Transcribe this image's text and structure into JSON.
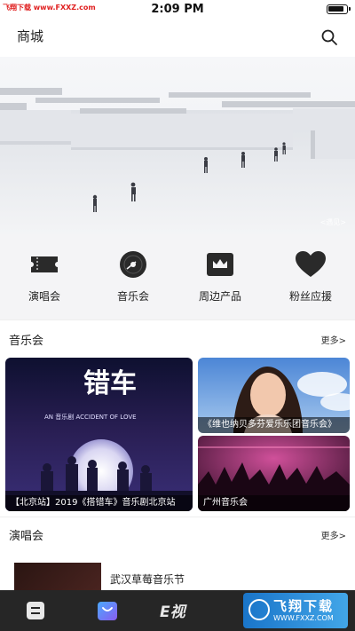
{
  "status_bar": {
    "watermark": "飞翔下载 www.FXXZ.com",
    "time": "2:09 PM"
  },
  "nav": {
    "title": "商城",
    "search_icon": "search-icon"
  },
  "hero": {
    "credit": "<遇见>"
  },
  "categories": [
    {
      "label": "演唱会",
      "icon": "ticket-icon"
    },
    {
      "label": "音乐会",
      "icon": "vinyl-record-icon"
    },
    {
      "label": "周边产品",
      "icon": "crown-card-icon"
    },
    {
      "label": "粉丝应援",
      "icon": "heart-icon"
    }
  ],
  "music_section": {
    "title": "音乐会",
    "more": "更多>",
    "cards": [
      {
        "caption": "【北京站】2019《搭错车》音乐剧北京站",
        "poster_title": "错车",
        "poster_en": "AN 音乐剧 ACCIDENT OF LOVE"
      },
      {
        "caption": "《维也纳贝多芬爱乐乐团音乐会》"
      },
      {
        "caption": "广州音乐会"
      }
    ]
  },
  "concert_section": {
    "title": "演唱会",
    "more": "更多>",
    "items": [
      {
        "title": "武汉草莓音乐节"
      }
    ]
  },
  "tab_bar": {
    "tabs": [
      {
        "icon": "list-icon"
      },
      {
        "icon": "shop-bag-icon"
      },
      {
        "icon": "logo-icon",
        "label": "E视"
      }
    ],
    "watermark_main": "飞翔下载",
    "watermark_sub": "WWW.FXXZ.COM"
  },
  "colors": {
    "accent": "#5b6fd6",
    "icon_dark": "#2a2a2a",
    "tab_bg": "#262626"
  }
}
